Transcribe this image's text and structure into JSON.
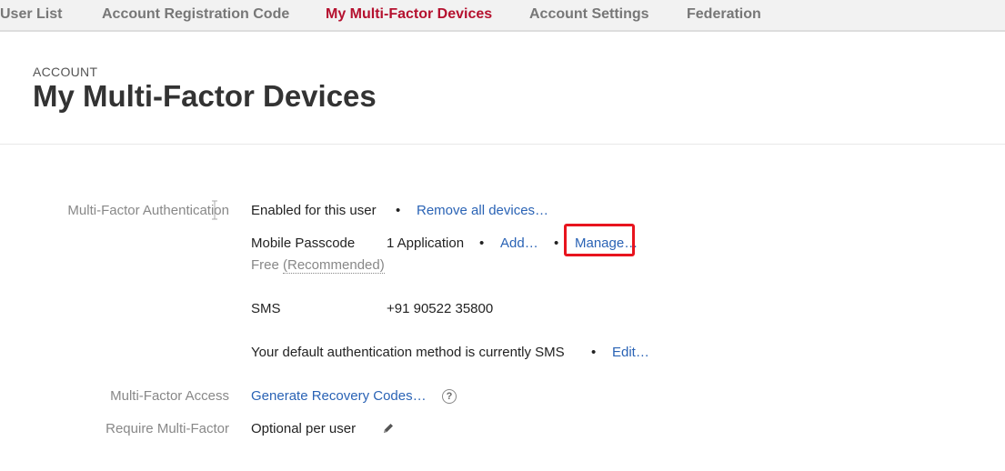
{
  "tabs": [
    {
      "label": "User List",
      "active": false
    },
    {
      "label": "Account Registration Code",
      "active": false
    },
    {
      "label": "My Multi-Factor Devices",
      "active": true
    },
    {
      "label": "Account Settings",
      "active": false
    },
    {
      "label": "Federation",
      "active": false
    }
  ],
  "header": {
    "eyebrow": "ACCOUNT",
    "title": "My Multi-Factor Devices"
  },
  "mfa": {
    "label": "Multi-Factor Authentication",
    "status": "Enabled for this user",
    "remove_link": "Remove all devices…",
    "mobile": {
      "name": "Mobile Passcode",
      "count": "1 Application",
      "add_link": "Add…",
      "manage_link": "Manage…",
      "price": "Free",
      "recommended": "(Recommended)"
    },
    "sms": {
      "name": "SMS",
      "phone": "+91 90522 35800"
    },
    "default_method_text": "Your default authentication method is currently SMS",
    "edit_link": "Edit…"
  },
  "access": {
    "label": "Multi-Factor Access",
    "recovery_link": "Generate Recovery Codes…"
  },
  "require": {
    "label": "Require Multi-Factor",
    "value": "Optional per user"
  },
  "bullet": "•",
  "help_glyph": "?",
  "colors": {
    "active_tab": "#b5112f",
    "link": "#2a63b5",
    "highlight": "#e8141e"
  }
}
